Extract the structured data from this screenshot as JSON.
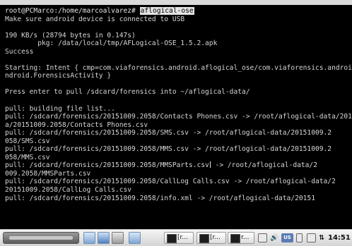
{
  "terminal": {
    "prompt": "root@PCMarco:/home/marcoalvarez#",
    "command": "aflogical-ose",
    "lines": [
      "Make sure android device is connected to USB",
      "",
      "190 KB/s (28794 bytes in 0.147s)",
      "        pkg: /data/local/tmp/AFLogical-OSE_1.5.2.apk",
      "Success",
      "",
      "Starting: Intent { cmp=com.viaforensics.android.aflogical_ose/com.viaforensics.android.ForensicsActivity }",
      "ndroid.ForensicsActivity }",
      "",
      "Press enter to pull /sdcard/forensics into ~/aflogical-data/",
      "",
      "pull: building file list...",
      "pull: /sdcard/forensics/20151009.2058/Contacts Phones.csv -> /root/aflogical-data/201",
      "a/20151009.2058/Contacts Phones.csv",
      "pull: /sdcard/forensics/20151009.2058/SMS.csv -> /root/aflogical-data/20151009.2",
      "058/SMS.csv",
      "pull: /sdcard/forensics/20151009.2058/MMS.csv -> /root/aflogical-data/20151009.2",
      "058/MMS.csv",
      "pull: /sdcard/forensics/20151009.2058/MMSParts.csv",
      " -> /root/aflogical-data/2",
      "009.2058/MMSParts.csv",
      "pull: /sdcard/forensics/20151009.2058/CallLog Calls.csv -> /root/aflogical-data/2",
      "20151009.2058/CallLog Calls.csv",
      "pull: /sdcard/forensics/20151009.2058/info.xml -> /root/aflogical-data/20151"
    ]
  },
  "taskbar": {
    "buttons": [
      {
        "label": "[r..."
      },
      {
        "label": "[r..."
      },
      {
        "label": "r..."
      }
    ],
    "tray_badge": "US",
    "clock": "14:51"
  }
}
